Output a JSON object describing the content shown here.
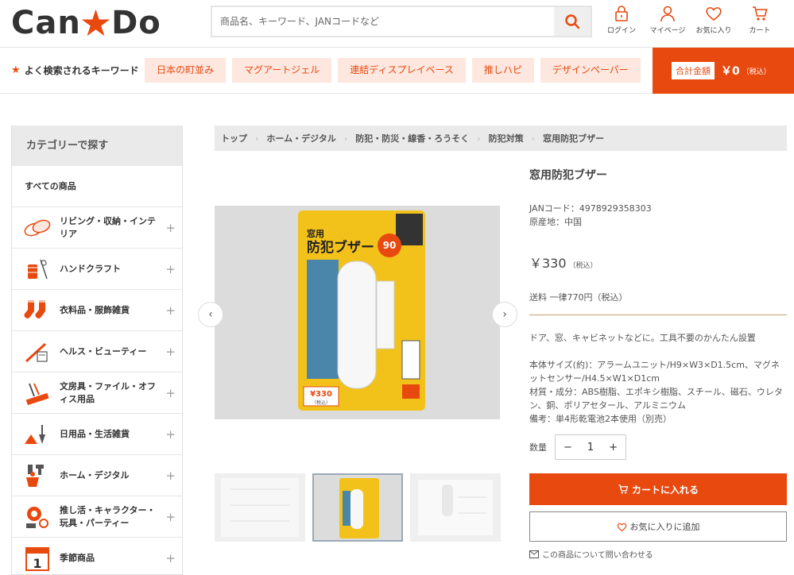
{
  "header": {
    "logo_left": "Can",
    "logo_star": "★",
    "logo_right": "Do",
    "search_placeholder": "商品名、キーワード、JANコードなど",
    "icons": [
      {
        "label": "ログイン",
        "icon": "lock-icon"
      },
      {
        "label": "マイページ",
        "icon": "user-icon"
      },
      {
        "label": "お気に入り",
        "icon": "heart-icon"
      },
      {
        "label": "カート",
        "icon": "cart-icon"
      }
    ]
  },
  "keywords": {
    "label": "よく検索されるキーワード",
    "tags": [
      "日本の町並み",
      "マグアートジェル",
      "連結ディスプレイベース",
      "推しハピ",
      "デザインペーパー"
    ]
  },
  "total": {
    "label": "合計金額",
    "amount": "￥0",
    "tax": "（税込）"
  },
  "sidebar": {
    "title": "カテゴリーで探す",
    "all": "すべての商品",
    "categories": [
      {
        "label": "リビング・収納・インテリア",
        "icon": "living-icon"
      },
      {
        "label": "ハンドクラフト",
        "icon": "craft-icon"
      },
      {
        "label": "衣料品・服飾雑貨",
        "icon": "socks-icon"
      },
      {
        "label": "ヘルス・ビューティー",
        "icon": "beauty-icon"
      },
      {
        "label": "文房具・ファイル・オフィス用品",
        "icon": "stationery-icon"
      },
      {
        "label": "日用品・生活雑貨",
        "icon": "daily-goods-icon"
      },
      {
        "label": "ホーム・デジタル",
        "icon": "home-digital-icon"
      },
      {
        "label": "推し活・キャラクター・玩具・パーティー",
        "icon": "toy-icon"
      },
      {
        "label": "季節商品",
        "icon": "calendar-icon"
      }
    ]
  },
  "breadcrumb": [
    "トップ",
    "ホーム・デジタル",
    "防犯・防災・線香・ろうそく",
    "防犯対策",
    "窓用防犯ブザー"
  ],
  "product": {
    "title": "窓用防犯ブザー",
    "jan": "JANコード：4978929358303",
    "origin": "原産地：中国",
    "price": "￥330",
    "price_tax": "（税込）",
    "shipping": "送料 一律770円（税込）",
    "desc": "ドア、窓、キャビネットなどに。工具不要のかんたん設置",
    "size": "本体サイズ(約)：アラームユニット/H9×W3×D1.5cm、マグネットセンサー/H4.5×W1×D1cm",
    "material": "材質・成分：ABS樹脂、エポキシ樹脂、スチール、磁石、ウレタン、銅、ポリアセタール、アルミニウム",
    "note": "備考：単4形乾電池2本使用（別売）",
    "package_label": "窓用",
    "package_title": "防犯ブザー",
    "package_price": "¥330",
    "package_price_tax": "（税込）"
  },
  "quantity": {
    "label": "数量",
    "value": "1",
    "minus": "−",
    "plus": "+"
  },
  "actions": {
    "cart": "カートに入れる",
    "favorite": "お気に入りに追加",
    "inquiry": "この商品について問い合わせる"
  },
  "colors": {
    "accent": "#e8490f",
    "tag_bg": "#fde7df"
  }
}
